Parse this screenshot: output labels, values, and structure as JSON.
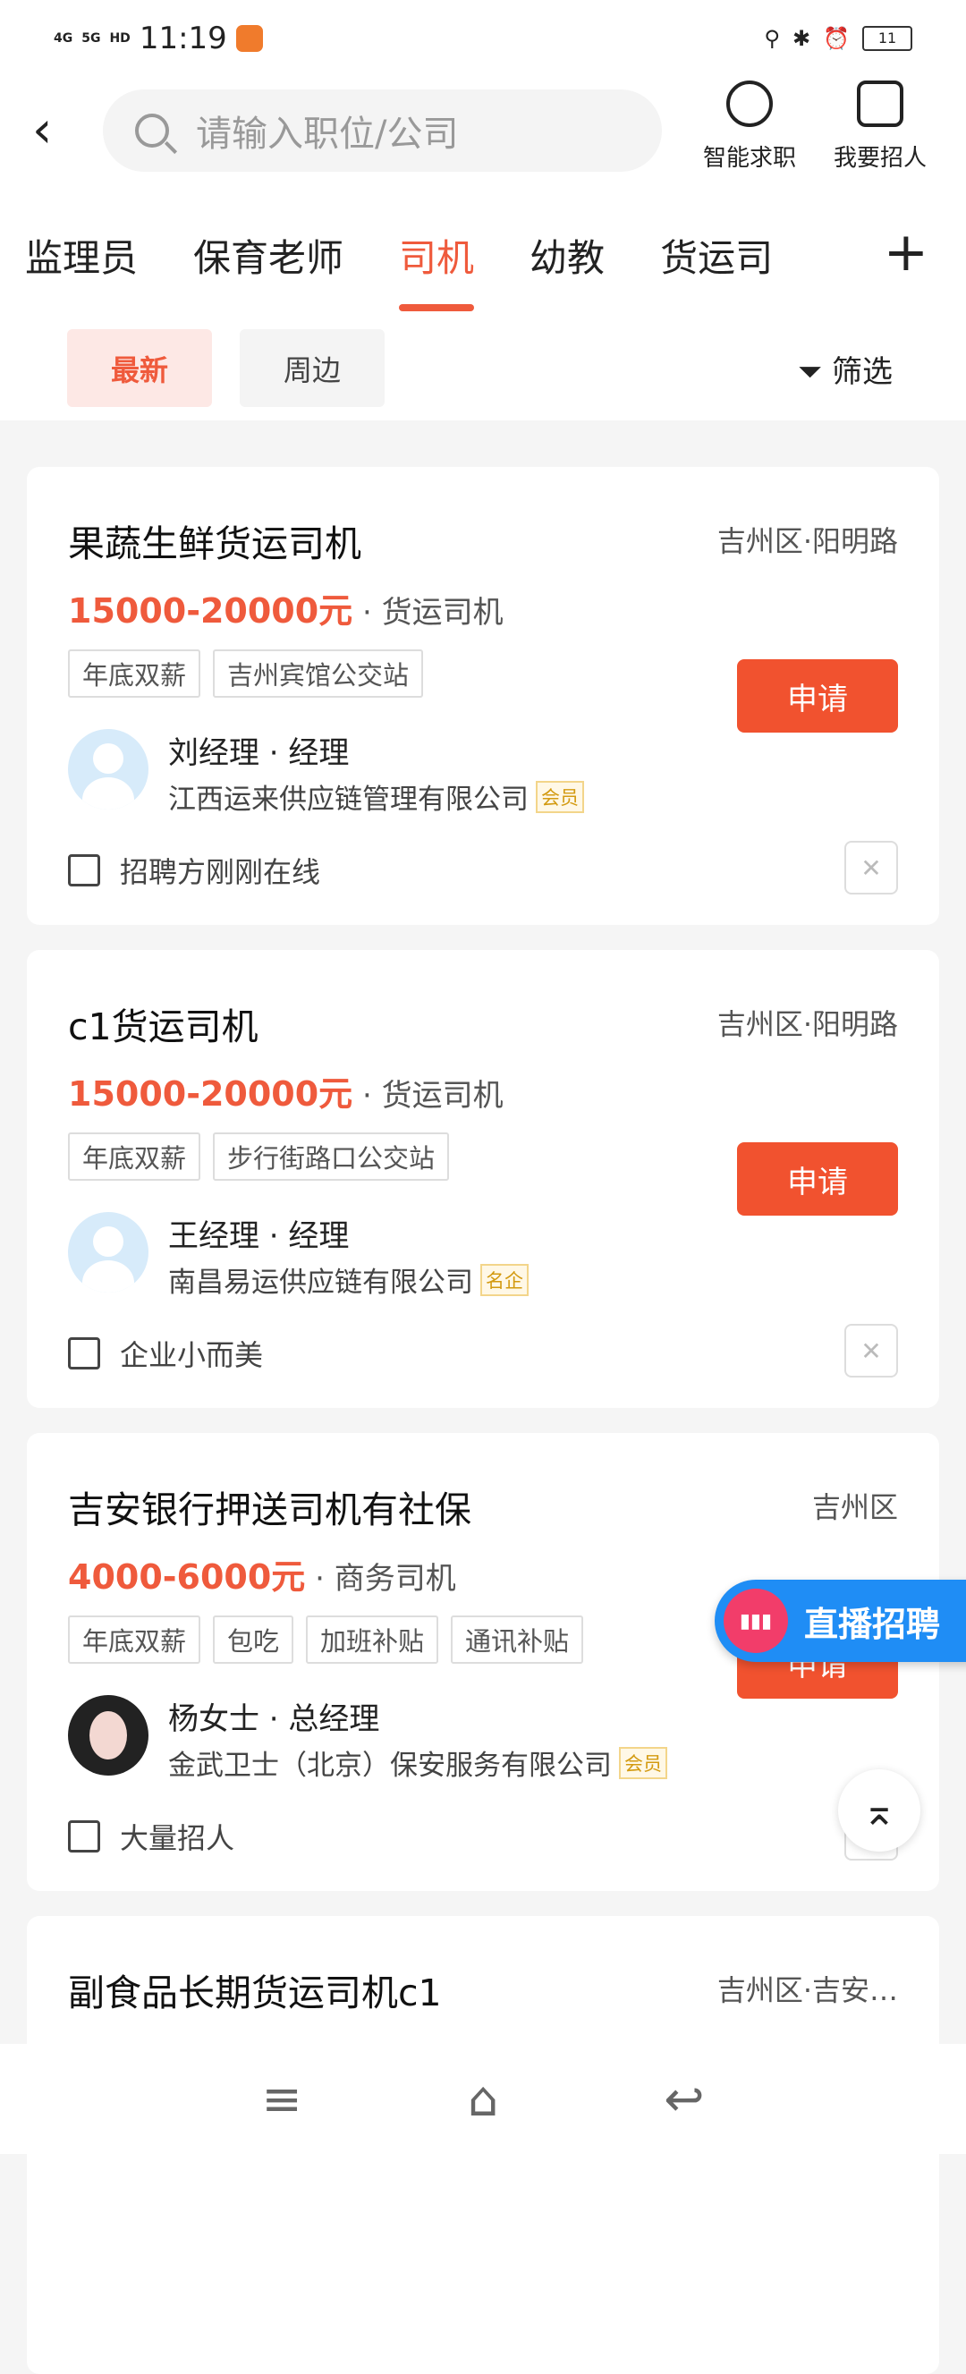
{
  "status": {
    "time": "11:19",
    "net1": "4G",
    "net2": "5G",
    "hd": "HD",
    "battery": "11"
  },
  "header": {
    "search_placeholder": "请输入职位/公司",
    "ai_label": "智能求职",
    "recruit_label": "我要招人"
  },
  "tabs": [
    "监理员",
    "保育老师",
    "司机",
    "幼教",
    "货运司"
  ],
  "active_tab": 2,
  "chips": {
    "latest": "最新",
    "nearby": "周边",
    "filter": "筛选"
  },
  "apply_label": "申请",
  "jobs": [
    {
      "title": "果蔬生鲜货运司机",
      "location": "吉州区·阳明路",
      "salary": "15000-20000元",
      "category": "货运司机",
      "tags": [
        "年底双薪",
        "吉州宾馆公交站"
      ],
      "person": "刘经理 · 经理",
      "company": "江西运来供应链管理有限公司",
      "badge": "会员",
      "footer": "招聘方刚刚在线",
      "footer_icon": "chat-icon",
      "avatar": "default"
    },
    {
      "title": "c1货运司机",
      "location": "吉州区·阳明路",
      "salary": "15000-20000元",
      "category": "货运司机",
      "tags": [
        "年底双薪",
        "步行街路口公交站"
      ],
      "person": "王经理 · 经理",
      "company": "南昌易运供应链有限公司",
      "badge": "名企",
      "footer": "企业小而美",
      "footer_icon": "cube-icon",
      "avatar": "default"
    },
    {
      "title": "吉安银行押送司机有社保",
      "location": "吉州区",
      "salary": "4000-6000元",
      "category": "商务司机",
      "tags": [
        "年底双薪",
        "包吃",
        "加班补贴",
        "通讯补贴"
      ],
      "person": "杨女士 · 总经理",
      "company": "金武卫士（北京）保安服务有限公司",
      "badge": "会员",
      "footer": "大量招人",
      "footer_icon": "document-icon",
      "avatar": "photo"
    },
    {
      "title": "副食品长期货运司机c1",
      "location": "吉州区·吉安…"
    }
  ],
  "live": {
    "label": "直播招聘"
  },
  "colors": {
    "accent": "#ef5a3c",
    "apply": "#f1522f",
    "live": "#1f8df5"
  }
}
